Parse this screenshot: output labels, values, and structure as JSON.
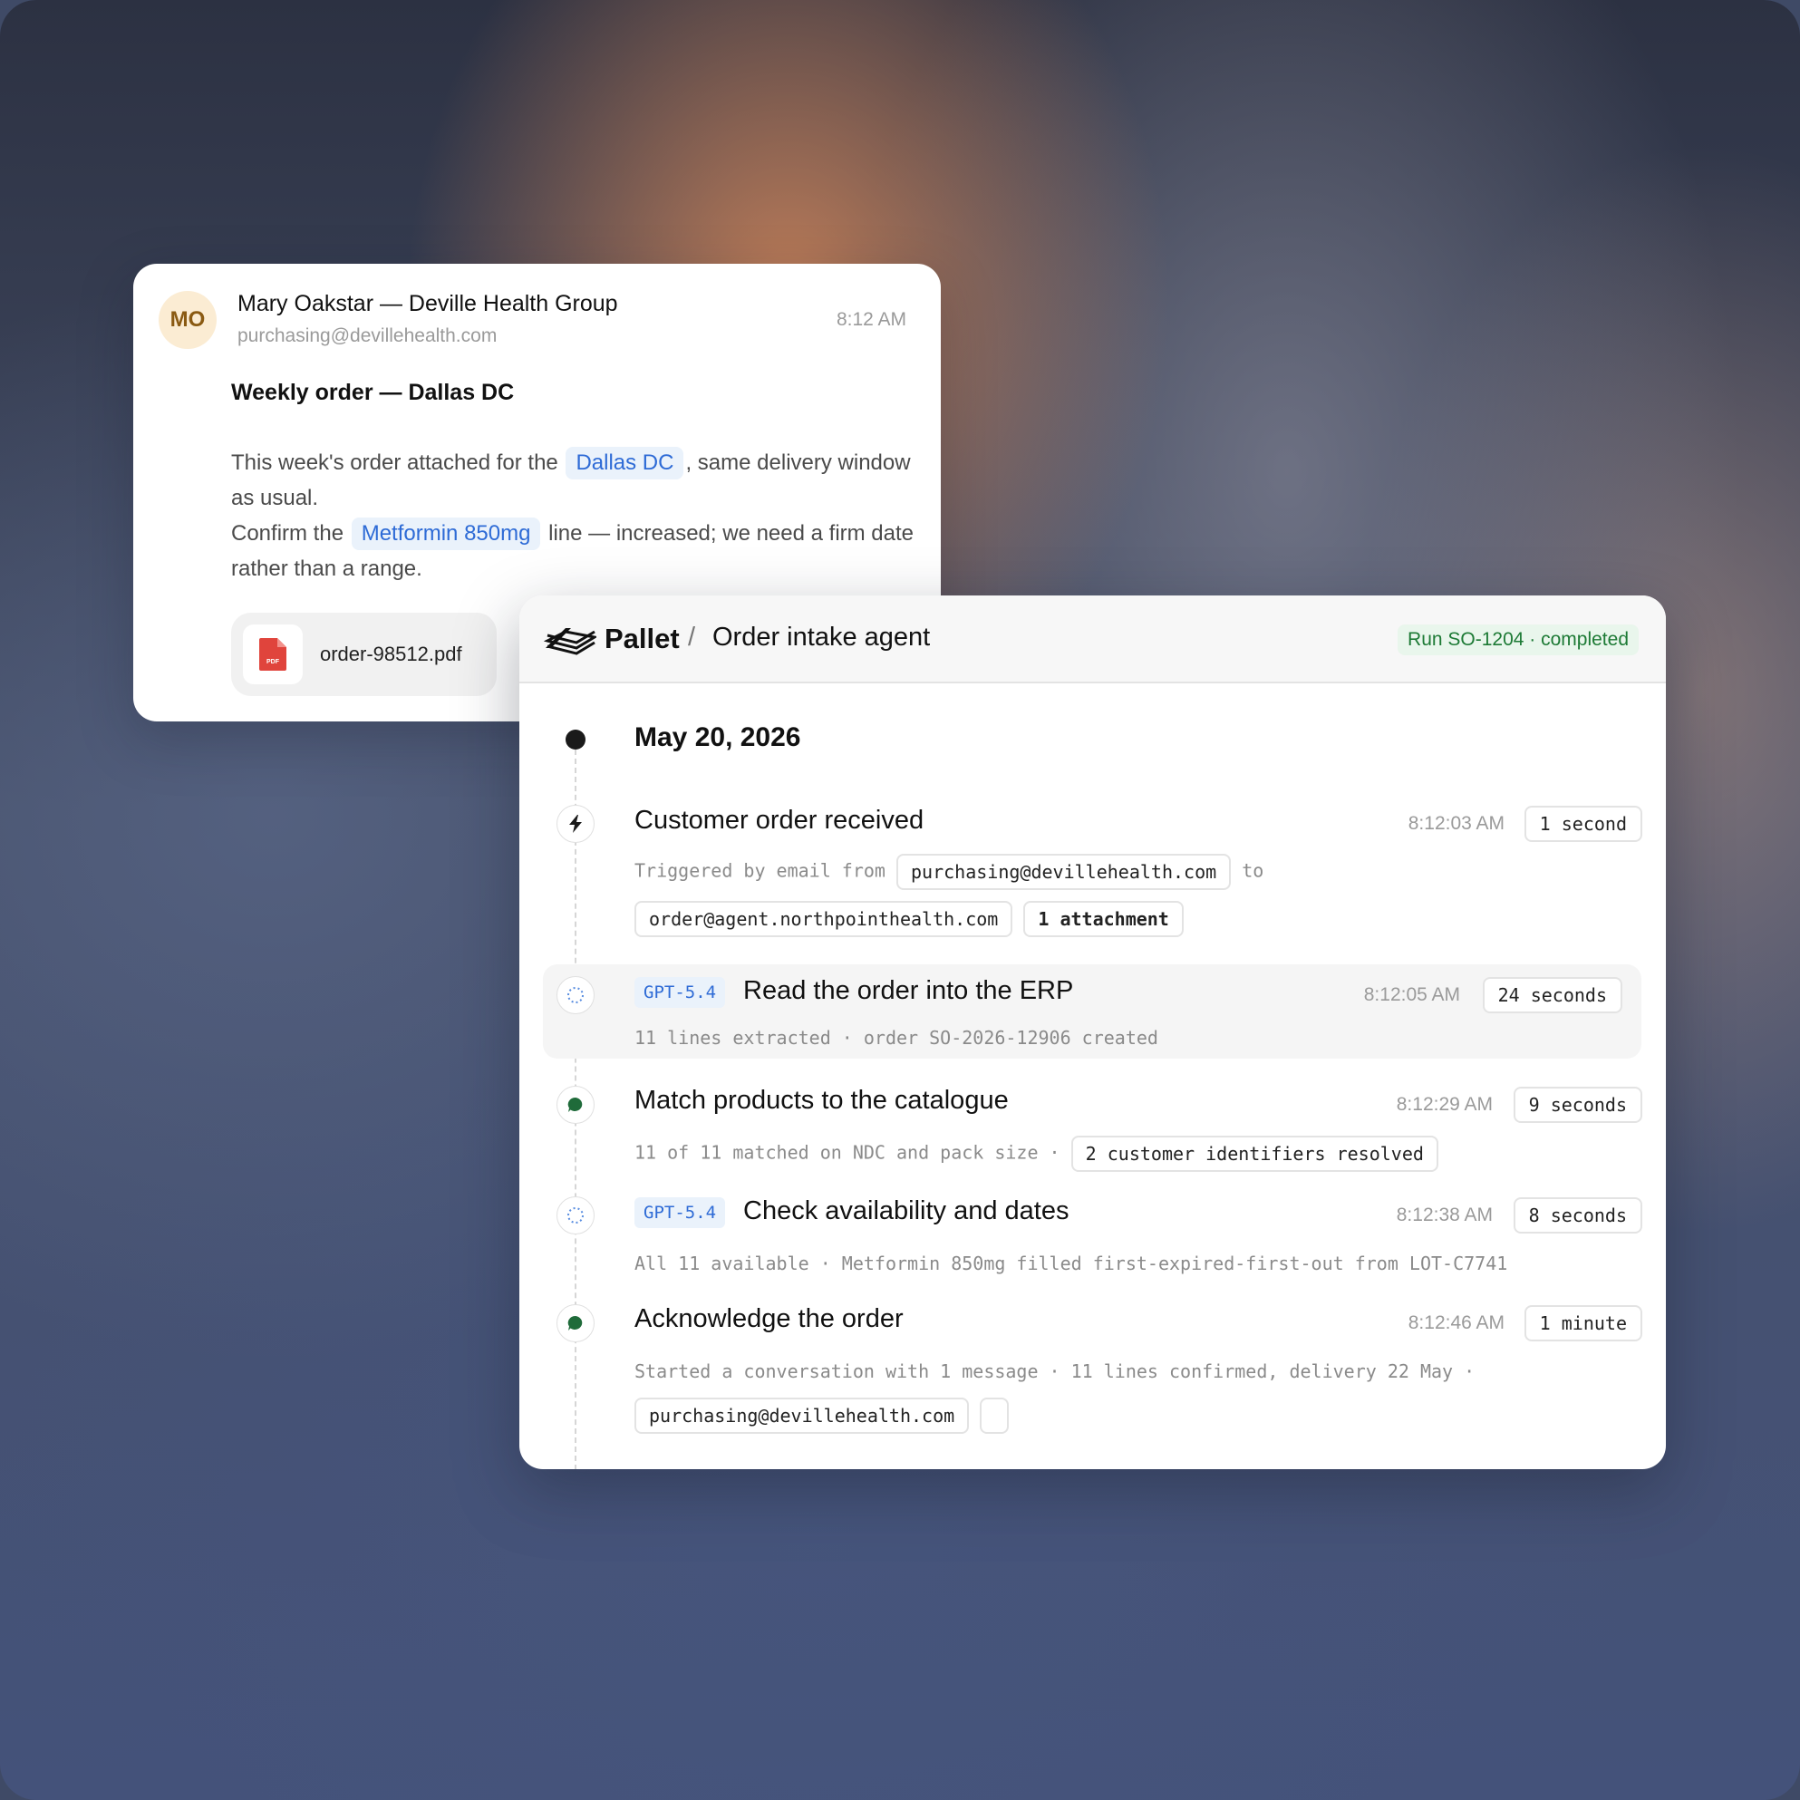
{
  "email": {
    "avatar_initials": "MO",
    "sender_name": "Mary Oakstar — Deville Health Group",
    "sender_email": "purchasing@devillehealth.com",
    "time": "8:12 AM",
    "subject": "Weekly order — Dallas DC",
    "body": {
      "p1_before": "This week's order attached for the",
      "p1_chip": "Dallas DC",
      "p1_after": ", same delivery window as usual.",
      "p2_before": "Confirm the",
      "p2_chip": "Metformin 850mg",
      "p2_after": "line — increased; we need a firm date rather than a range."
    },
    "attachment": {
      "filename": "order-98512.pdf",
      "icon_label": "PDF",
      "icon": "pdf-file-icon",
      "icon_color": "#e0443c"
    }
  },
  "panel": {
    "brand": "Pallet",
    "separator": "/",
    "title": "Order intake agent",
    "run_badge": "Run SO-1204 · completed",
    "date": "May 20, 2026",
    "steps": [
      {
        "icon": "lightning-icon",
        "title": "Customer order received",
        "time": "8:12:03 AM",
        "duration": "1 second",
        "detail_prefix": "Triggered by email from",
        "from_chip": "purchasing@devillehealth.com",
        "to_word": "to",
        "to_chip": "order@agent.northpointhealth.com",
        "attachments_chip": "1 attachment"
      },
      {
        "icon": "spinner-icon",
        "model": "GPT-5.4",
        "title": "Read the order into the ERP",
        "time": "8:12:05 AM",
        "duration": "24 seconds",
        "detail": "11 lines extracted · order SO-2026-12906 created"
      },
      {
        "icon": "chat-bubble-icon",
        "title": "Match products to the catalogue",
        "time": "8:12:29 AM",
        "duration": "9 seconds",
        "detail": "11 of 11 matched on NDC and pack size ·",
        "chip": "2 customer identifiers resolved"
      },
      {
        "icon": "spinner-icon",
        "model": "GPT-5.4",
        "title": "Check availability and dates",
        "time": "8:12:38 AM",
        "duration": "8 seconds",
        "detail": "All 11 available · Metformin 850mg filled first-expired-first-out from LOT-C7741"
      },
      {
        "icon": "chat-bubble-icon",
        "title": "Acknowledge the order",
        "time": "8:12:46 AM",
        "duration": "1 minute",
        "detail": "Started a conversation with 1 message · 11 lines confirmed, delivery 22 May ·",
        "chip": "purchasing@devillehealth.com"
      }
    ]
  },
  "colors": {
    "accent_blue": "#2e6bd6",
    "success_green": "#1d7a35",
    "node_green": "#1f6b3a",
    "avatar_bg": "#fbecd3"
  }
}
